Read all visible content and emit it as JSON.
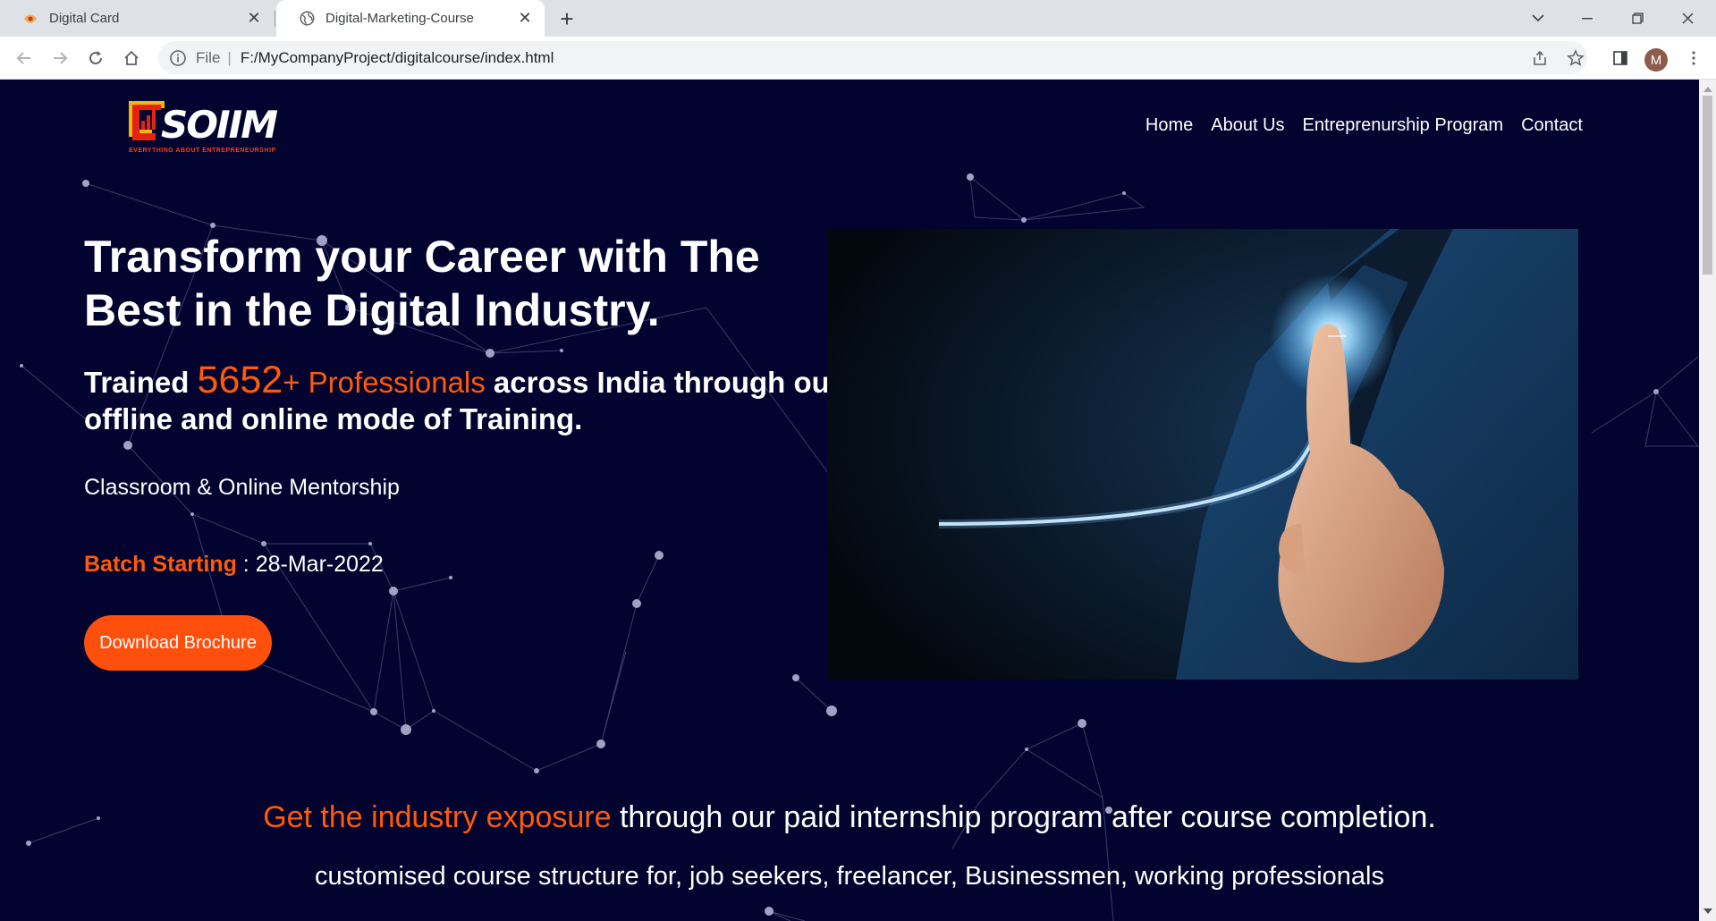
{
  "browser": {
    "tabs": [
      {
        "title": "Digital Card",
        "active": false
      },
      {
        "title": "Digital-Marketing-Course",
        "active": true
      }
    ],
    "address": {
      "scheme": "File",
      "url": "F:/MyCompanyProject/digitalcourse/index.html"
    },
    "profile_initial": "M"
  },
  "page": {
    "logo": {
      "text": "SOIIM",
      "tagline": "EVERYTHING ABOUT ENTREPRENEURSHIP"
    },
    "nav": [
      "Home",
      "About Us",
      "Entreprenurship Program",
      "Contact"
    ],
    "hero": {
      "title": "Transform your Career with The Best in the Digital Industry.",
      "trained_prefix": "Trained ",
      "trained_count": "5652",
      "trained_plus": "+",
      "trained_professionals": " Professionals",
      "trained_suffix": " across India through our offline and online mode of Training.",
      "mentorship": "Classroom & Online Mentorship",
      "batch_label": "Batch Starting",
      "batch_sep": " : ",
      "batch_date": "28-Mar-2022",
      "cta": "Download Brochure"
    },
    "exposure_highlight": "Get the industry exposure",
    "exposure_rest": " through our paid internship program after course completion.",
    "customised": "customised course structure for, job seekers, freelancer, Businessmen, working professionals"
  },
  "colors": {
    "background": "#02032e",
    "accent": "#ff5a0a",
    "button": "#fe4f0c"
  }
}
